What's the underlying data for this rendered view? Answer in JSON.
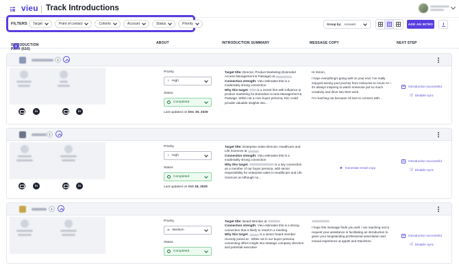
{
  "app": {
    "logo": "vieu",
    "title": "Track Introductions"
  },
  "filters": {
    "label": "FILTERS",
    "pills": [
      "Target",
      "Point of contact",
      "Cohorts",
      "Account",
      "Status",
      "Priority"
    ]
  },
  "toolbar": {
    "group_by_label": "Group by:",
    "group_by_value": "Account",
    "add_intro_label": "ADD AN INTRO"
  },
  "columns": {
    "path": "INTRODUCTION PATH (616)",
    "path_badge": "2",
    "about": "ABOUT",
    "summary": "INTRODUCTION SUMMARY",
    "message": "MESSAGE COPY",
    "next": "NEXT STEP"
  },
  "groups": [
    {
      "count": "1",
      "priority_label": "Priority",
      "priority_value": "High",
      "status_label": "Status",
      "status_value": "Completed",
      "updated_prefix": "Last updated on",
      "updated_date": "Dec 30, 2025",
      "summary": {
        "target_title_label": "Target title:",
        "target_title": " Director, Product Marketing (Extended Access Management & Passage) at",
        "strength_label": "Connection strength:",
        "strength": " Vieu estimates this is a moderately strong connection",
        "why_label": "Why this target:",
        "why": " is a recent hire with influence in product marketing for Extended Access Management & Passage. While not a core buyer persona, Eric could provide valuable insights into..."
      },
      "message": {
        "greeting": "Hi Simon,",
        "p1": "I hope everything's going well on your end. I've really enjoyed seeing your journey from HoloLens to Azure AI—it's always inspiring to watch someone put so much creativity and drive into their work.",
        "p2": "I'm reaching out because I'd love to connect with..."
      },
      "next": {
        "step": "Introduction successful",
        "disable": "Disable sync"
      }
    },
    {
      "count": "1",
      "priority_label": "Priority",
      "priority_value": "High",
      "status_label": "Status",
      "status_value": "Completed",
      "updated_prefix": "Last updated on",
      "updated_date": "Oct 18, 2025",
      "summary": {
        "target_title_label": "Target title:",
        "target_title": " Enterprise Sales Director, Healthcare and Life Sciences at",
        "strength_label": "Connection strength:",
        "strength": " Vieu estimates this is a moderately strong connection",
        "why_label": "Why this target:",
        "why": " is a key connection as a member of our buyer persona, with senior responsibility for enterprise sales in Healthcare and Life Sciences at        Although no..."
      },
      "generate": "Generate email copy",
      "next": {
        "step": "Introduction successful",
        "disable": "Disable sync"
      }
    },
    {
      "count": "1",
      "priority_label": "Priority",
      "priority_value": "Medium",
      "status_label": "Status",
      "status_value": "Completed",
      "summary": {
        "target_title_label": "Target title:",
        "target_title": " Board Member at",
        "strength_label": "Connection strength:",
        "strength": " Vieu estimates this is a strong connection that is likely to result in a meeting",
        "why_label": "Why this target:",
        "why": " is a senior board member recently joined at        . While not in our buyer persona, connecting offers insight into strategic company direction and potential executive"
      },
      "message": {
        "p1": "I hope this message finds you well. I am reaching out to request your assistance in facilitating an introduction to                  given your longstanding professional association and mutual experience at appID and StackGen."
      },
      "next": {
        "step": "Introduction successful",
        "disable": "Disable sync"
      }
    }
  ],
  "colors": {
    "accent": "#5a3fe0",
    "highlight": "#5b3ce0",
    "success_bg": "#ecfaf0",
    "success_text": "#1d6e39"
  }
}
